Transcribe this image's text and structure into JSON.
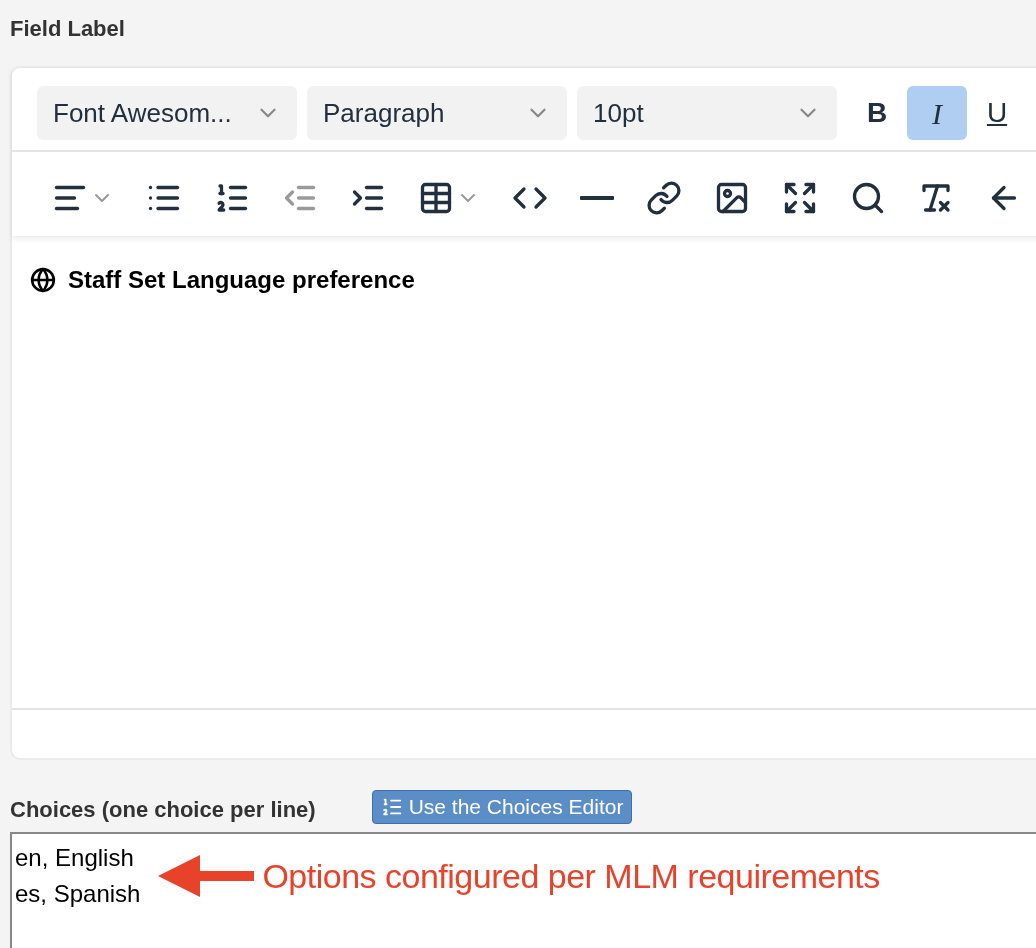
{
  "field_label": "Field Label",
  "editor": {
    "dropdowns": [
      {
        "value": "Font Awesom..."
      },
      {
        "value": "Paragraph"
      },
      {
        "value": "10pt"
      }
    ],
    "format_buttons": [
      {
        "label": "B",
        "kind": "bold",
        "selected": false
      },
      {
        "label": "I",
        "kind": "italic",
        "selected": true
      },
      {
        "label": "U",
        "kind": "underline",
        "selected": false
      }
    ],
    "tools": [
      {
        "kind": "align",
        "menu": true,
        "disabled": false
      },
      {
        "kind": "bullets",
        "menu": false,
        "disabled": false
      },
      {
        "kind": "numbers",
        "menu": false,
        "disabled": false
      },
      {
        "kind": "outdent",
        "menu": false,
        "disabled": true
      },
      {
        "kind": "indent",
        "menu": false,
        "disabled": false
      },
      {
        "kind": "table",
        "menu": true,
        "disabled": false
      },
      {
        "kind": "code",
        "menu": false,
        "disabled": false
      },
      {
        "kind": "rule",
        "menu": false,
        "disabled": false
      },
      {
        "kind": "link",
        "menu": false,
        "disabled": false
      },
      {
        "kind": "image",
        "menu": false,
        "disabled": false
      },
      {
        "kind": "fullscreen",
        "menu": false,
        "disabled": false
      },
      {
        "kind": "search",
        "menu": false,
        "disabled": false
      },
      {
        "kind": "clear",
        "menu": false,
        "disabled": false
      },
      {
        "kind": "back",
        "menu": false,
        "disabled": false
      }
    ],
    "content": "Staff Set Language preference"
  },
  "choices": {
    "label": "Choices (one choice per line)",
    "editor_button": "Use the Choices Editor",
    "lines": [
      "en, English",
      "es, Spanish"
    ]
  },
  "annotation": {
    "text": "Options configured per MLM requirements"
  }
}
